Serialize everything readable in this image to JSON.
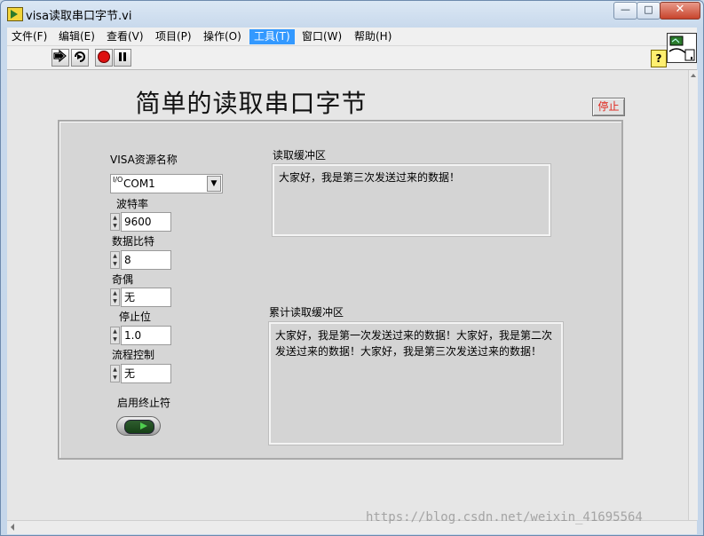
{
  "window": {
    "title": "visa读取串口字节.vi",
    "minimize_glyph": "—",
    "maximize_glyph": "□",
    "close_glyph": "✕"
  },
  "menu": {
    "items": [
      "文件(F)",
      "编辑(E)",
      "查看(V)",
      "项目(P)",
      "操作(O)",
      "工具(T)",
      "窗口(W)",
      "帮助(H)"
    ],
    "active": "工具(T)"
  },
  "toolbar": {
    "icons": [
      "run-arrow-icon",
      "run-continuously-icon",
      "abort-icon",
      "pause-icon"
    ],
    "help_label": "?"
  },
  "front_panel": {
    "title": "简单的读取串口字节",
    "stop_button_label": "停止",
    "visa_resource_label": "VISA资源名称",
    "visa_io_glyph": "I/O",
    "visa_resource_value": "COM1",
    "baud_label": "波特率",
    "baud_value": "9600",
    "data_bits_label": "数据比特",
    "data_bits_value": "8",
    "parity_label": "奇偶",
    "parity_value": "无",
    "stop_bits_label": "停止位",
    "stop_bits_value": "1.0",
    "flow_label": "流程控制",
    "flow_value": "无",
    "terminator_label": "启用终止符",
    "read_buffer_label": "读取缓冲区",
    "read_buffer_value": "大家好，我是第三次发送过来的数据！",
    "accum_buffer_label": "累计读取缓冲区",
    "accum_buffer_value": "大家好，我是第一次发送过来的数据！大家好，我是第二次发送过来的数据！大家好，我是第三次发送过来的数据！"
  },
  "watermark": "https://blog.csdn.net/weixin_41695564",
  "colors": {
    "active_menu": "#3399ff",
    "stop_text": "#e0241b",
    "panel_bg": "#e6e6e6"
  }
}
